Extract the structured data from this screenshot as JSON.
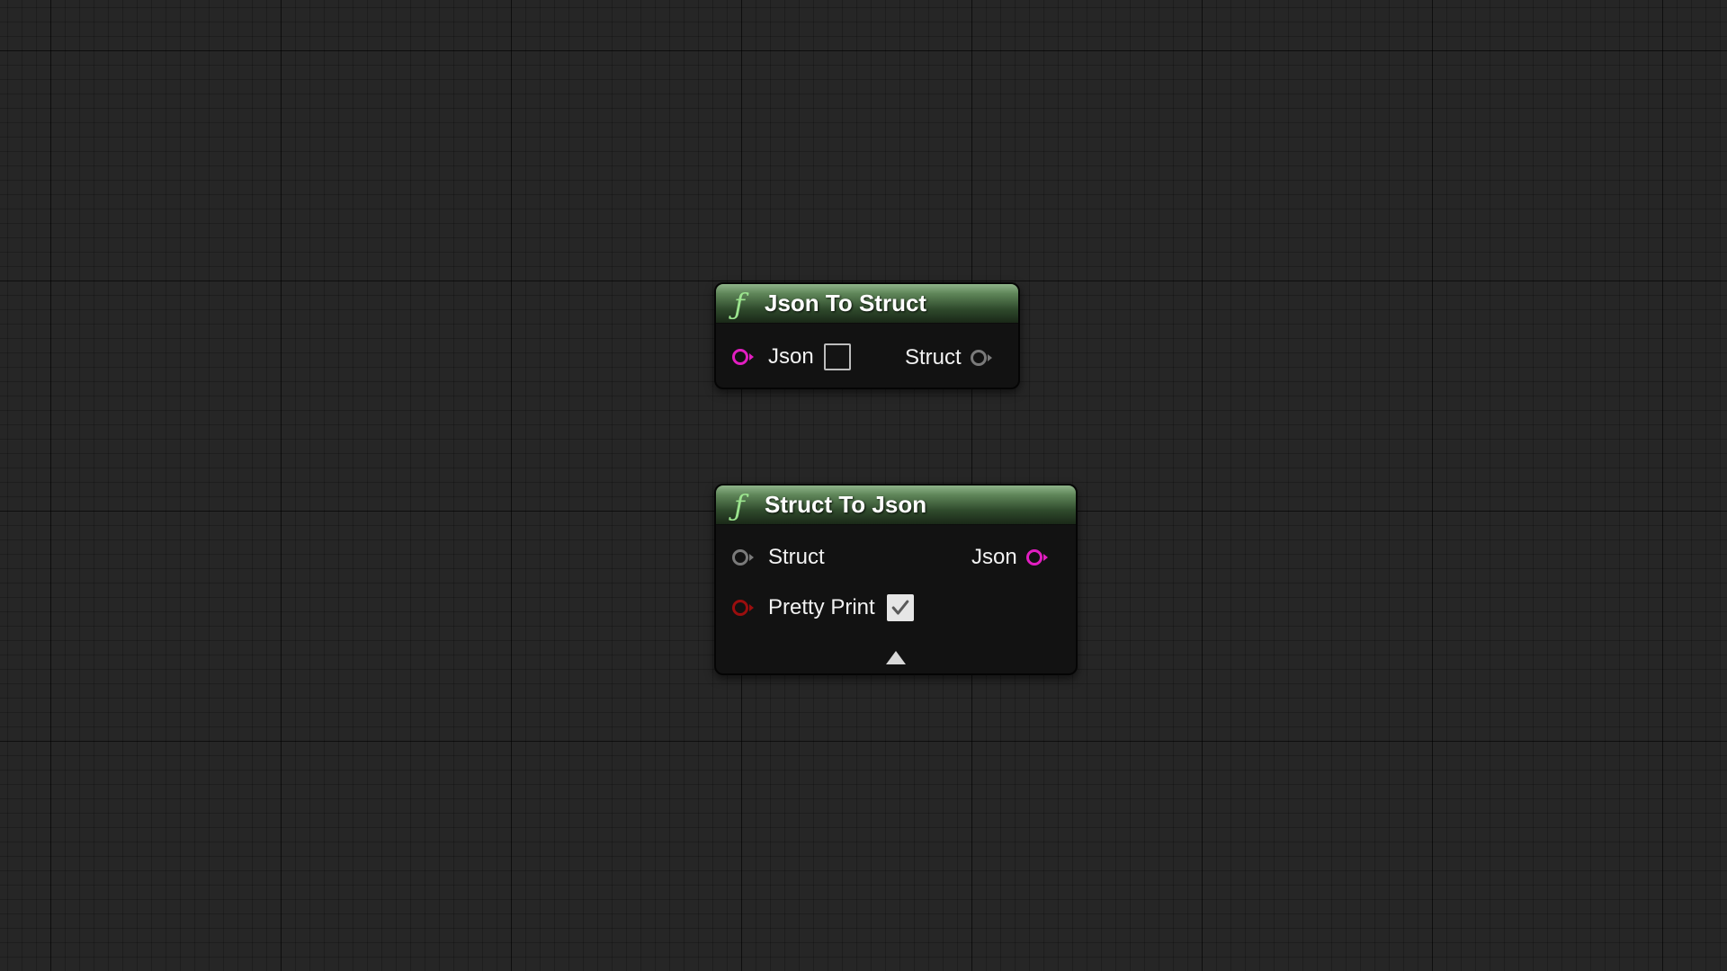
{
  "nodes": {
    "json_to_struct": {
      "icon": "function-icon",
      "icon_glyph": "ƒ",
      "title": "Json To Struct",
      "inputs": [
        {
          "label": "Json",
          "pin_color": "#e21ec1",
          "checkbox_checked": false
        }
      ],
      "outputs": [
        {
          "label": "Struct",
          "pin_color": "#7a7a7a"
        }
      ]
    },
    "struct_to_json": {
      "icon": "function-icon",
      "icon_glyph": "ƒ",
      "title": "Struct To Json",
      "inputs": [
        {
          "label": "Struct",
          "pin_color": "#7a7a7a"
        },
        {
          "label": "Pretty Print",
          "pin_color": "#9a0e0e",
          "checkbox_checked": true
        }
      ],
      "outputs": [
        {
          "label": "Json",
          "pin_color": "#e21ec1"
        }
      ],
      "advanced_toggle_icon": "collapse-arrow-up-icon"
    }
  },
  "colors": {
    "header_green": "#5e8558",
    "node_body": "#121212",
    "canvas_background": "#262626"
  }
}
